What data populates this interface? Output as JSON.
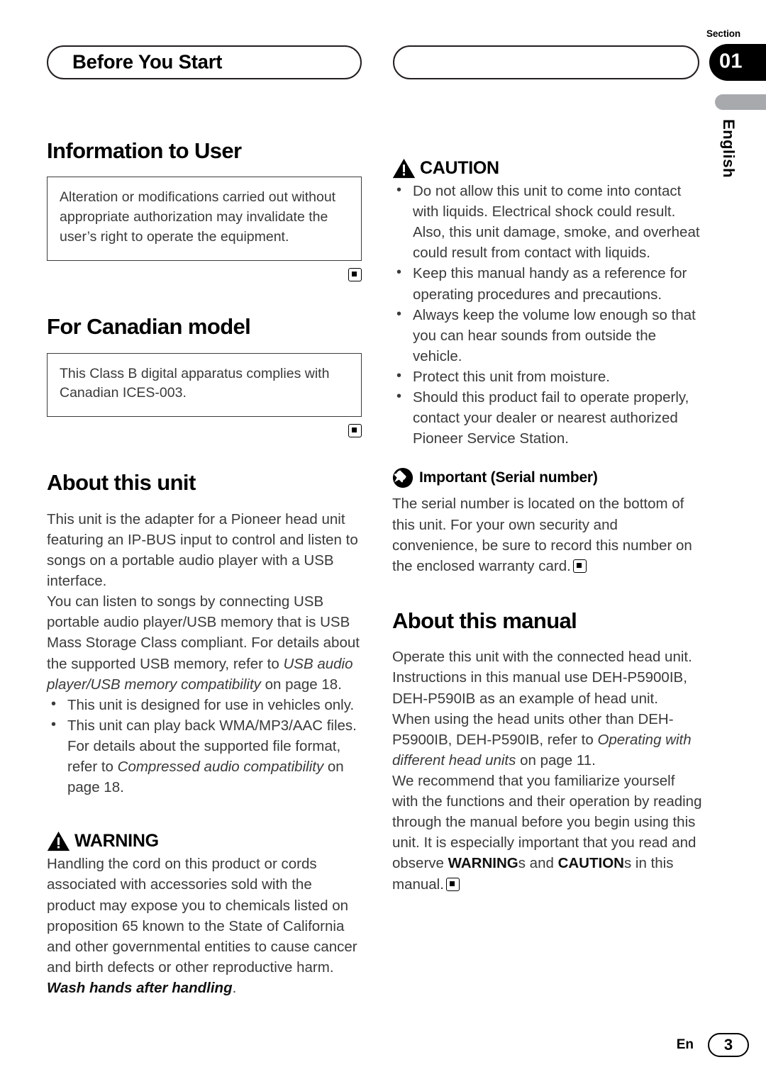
{
  "header": {
    "left_title": "Before You Start",
    "right_title": ""
  },
  "margin_tab": {
    "section_label": "Section",
    "section_number": "01",
    "language": "English",
    "accent_gray": "#a7a9ac",
    "accent_black": "#000000"
  },
  "left_column": {
    "section1": {
      "heading": "Information to User",
      "boxed_text": "Alteration or modifications carried out without appropriate authorization may invalidate the user’s right to operate the equipment."
    },
    "section2": {
      "heading": "For Canadian model",
      "boxed_text": "This Class B digital apparatus complies with Canadian ICES-003."
    },
    "section3": {
      "heading": "About this unit",
      "para1": "This unit is the adapter for a Pioneer head unit featuring an IP-BUS input to control and listen to songs on a portable audio player with a USB interface.",
      "para2_a": "You can listen to songs by connecting USB portable audio player/USB memory that is USB Mass Storage Class compliant. For details about the supported USB memory, refer to ",
      "para2_italic": "USB audio player/USB memory compatibility",
      "para2_b": " on page 18.",
      "bullets": [
        {
          "text_a": "This unit is designed for use in vehicles only.",
          "italic": "",
          "text_b": ""
        },
        {
          "text_a": "This unit can play back WMA/MP3/AAC files. For details about the supported file format, refer to ",
          "italic": "Compressed audio compatibility",
          "text_b": " on page 18."
        }
      ]
    },
    "warning": {
      "icon": "warning-triangle-icon",
      "title": "WARNING",
      "text_a": "Handling the cord on this product or cords associated with accessories sold with the product may expose you to chemicals listed on proposition 65 known to the State of California and other governmental entities to cause cancer and birth defects or other reproductive harm. ",
      "text_bold_italic": "Wash hands after handling",
      "text_b": "."
    }
  },
  "right_column": {
    "caution": {
      "icon": "warning-triangle-icon",
      "title": "CAUTION",
      "bullets": [
        "Do not allow this unit to come into contact with liquids. Electrical shock could result. Also, this unit damage, smoke, and overheat could result from contact with liquids.",
        "Keep this manual handy as a reference for operating procedures and precautions.",
        "Always keep the volume low enough so that you can hear sounds from outside the vehicle.",
        "Protect this unit from moisture.",
        "Should this product fail to operate properly, contact your dealer or nearest authorized Pioneer Service Station."
      ]
    },
    "important": {
      "icon": "pushpin-icon",
      "title": "Important (Serial number)",
      "text": "The serial number is located on the bottom of this unit. For your own security and convenience, be sure to record this number on the enclosed warranty card."
    },
    "about_manual": {
      "heading": "About this manual",
      "para1": "Operate this unit with the connected head unit. Instructions in this manual use DEH-P5900IB, DEH-P590IB as an example of head unit.",
      "para2_a": "When using the head units other than DEH-P5900IB, DEH-P590IB, refer to ",
      "para2_italic": "Operating with different head units",
      "para2_b": " on page 11.",
      "para3_a": "We recommend that you familiarize yourself with the functions and their operation by reading through the manual before you begin using this unit. It is especially important that you read and observe ",
      "para3_bold1": "WARNING",
      "para3_mid": "s and ",
      "para3_bold2": "CAUTION",
      "para3_b": "s in this manual."
    }
  },
  "footer": {
    "language_code": "En",
    "page_number": "3"
  }
}
